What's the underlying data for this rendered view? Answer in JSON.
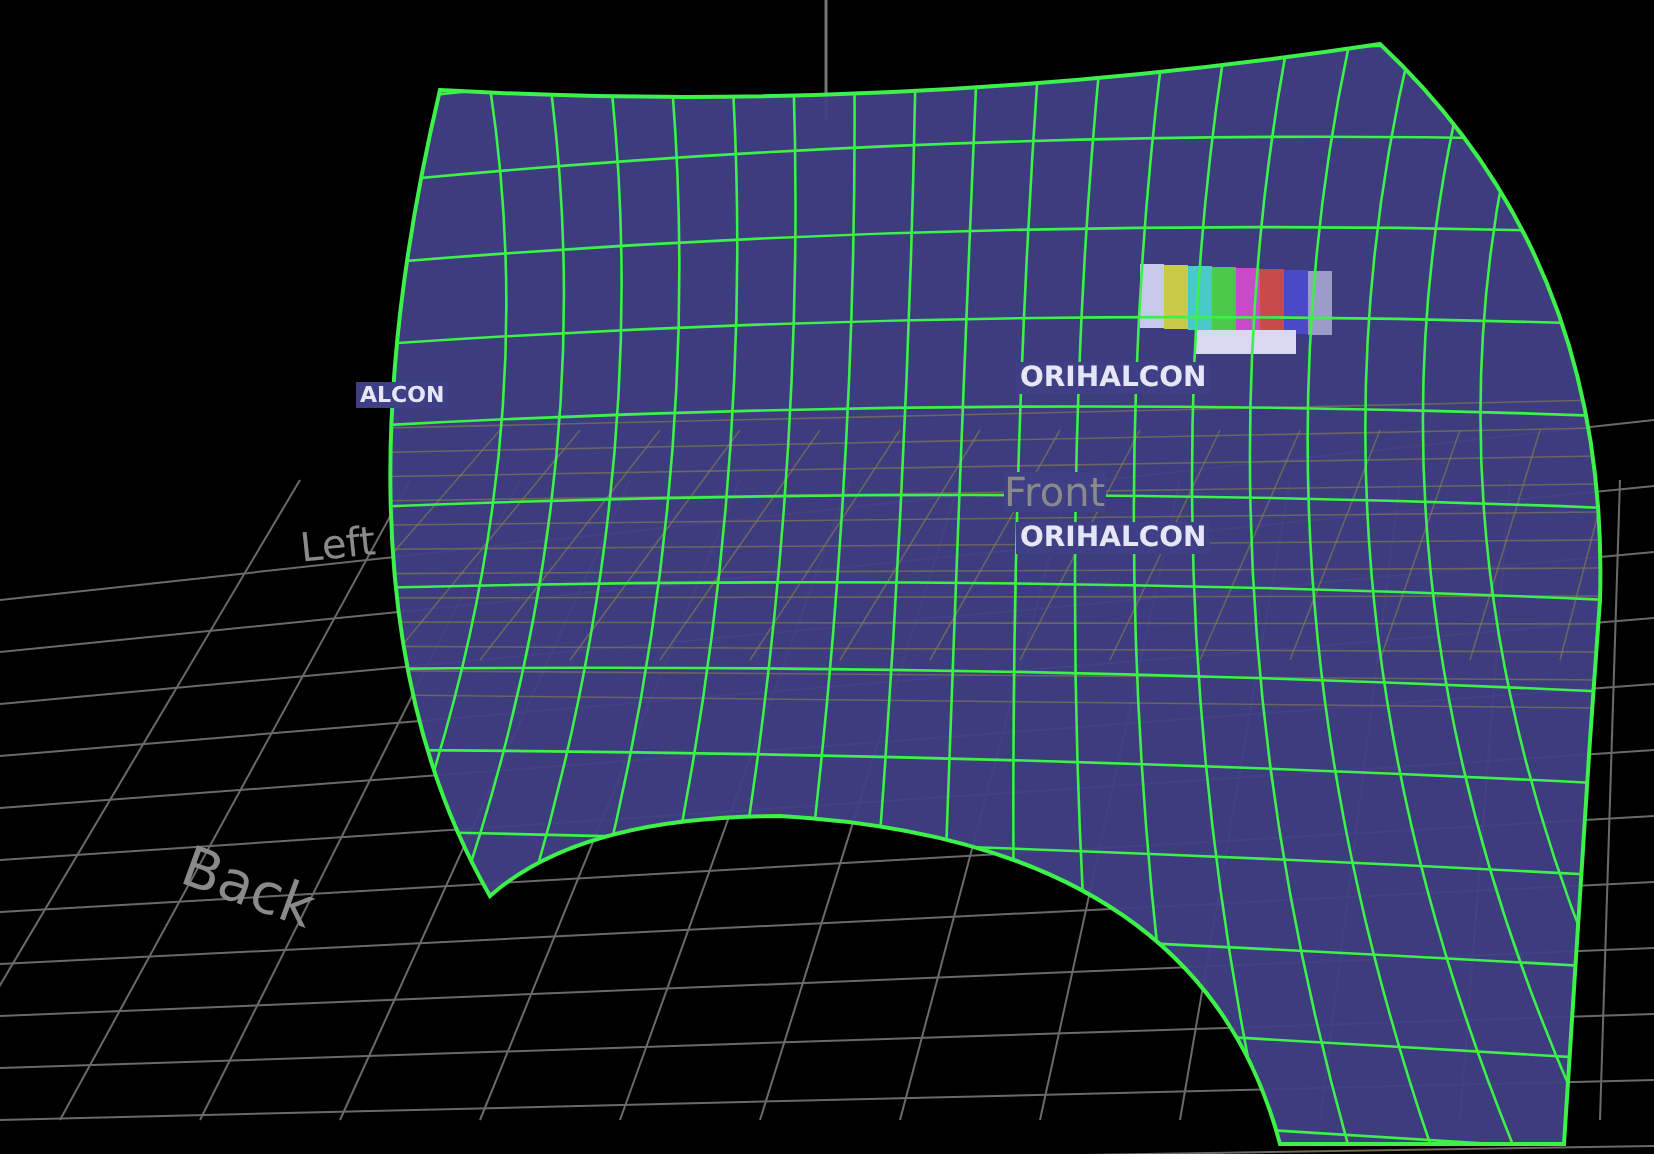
{
  "viewport": {
    "axis_labels": [
      {
        "kind": "front",
        "text": "Front"
      },
      {
        "kind": "left",
        "text": "Left"
      },
      {
        "kind": "back",
        "text": "Back"
      }
    ],
    "screen_logos": [
      "ORIHALCON",
      "ORIHALCON",
      "ALCON"
    ]
  }
}
